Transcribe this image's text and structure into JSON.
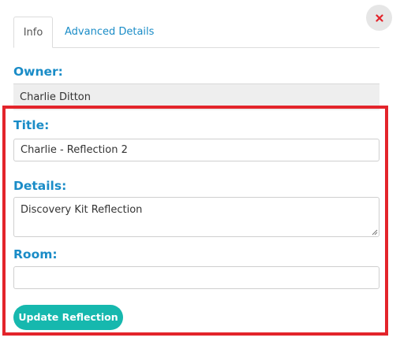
{
  "tabs": [
    {
      "label": "Info",
      "active": true
    },
    {
      "label": "Advanced Details",
      "active": false
    }
  ],
  "close_icon": "close-x-icon",
  "owner": {
    "label": "Owner:",
    "value": "Charlie Ditton"
  },
  "form": {
    "title_label": "Title:",
    "title_value": "Charlie - Reflection 2",
    "details_label": "Details:",
    "details_value": "Discovery Kit Reflection",
    "room_label": "Room:",
    "room_value": "",
    "submit_label": "Update Reflection"
  },
  "colors": {
    "accent": "#1a8cc7",
    "button": "#16b8ae",
    "highlight": "#e3242b",
    "close_icon": "#e3242b"
  }
}
